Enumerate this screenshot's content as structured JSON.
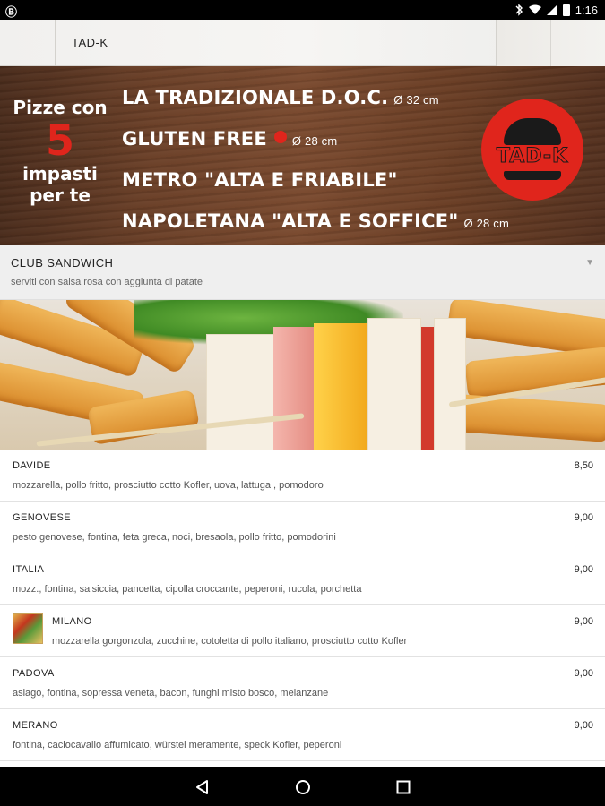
{
  "status_bar": {
    "app_icon": "app-notification-icon",
    "icons": [
      "bluetooth-icon",
      "wifi-icon",
      "signal-icon",
      "battery-icon"
    ],
    "time": "1:16"
  },
  "app_bar": {
    "title": "TAD-K"
  },
  "banner": {
    "left_text_top": "Pizze con",
    "big_number": "5",
    "left_text_bottom": "impasti per te",
    "lines": [
      {
        "label": "LA TRADIZIONALE  D.O.C.",
        "size": "Ø 32 cm"
      },
      {
        "label": "GLUTEN FREE",
        "size": "Ø 28 cm"
      },
      {
        "label": "METRO \"ALTA E FRIABILE\"",
        "size": ""
      },
      {
        "label": "NAPOLETANA \"ALTA E SOFFICE\"",
        "size": "Ø 28 cm"
      }
    ],
    "logo_text": "TAD-K",
    "colors": {
      "accent": "#e0251c",
      "wood": "#6b4028"
    }
  },
  "section": {
    "title": "CLUB SANDWICH",
    "subtitle": "serviti con salsa rosa con aggiunta di patate",
    "expand_icon": "chevron-down-icon"
  },
  "items": [
    {
      "name": "DAVIDE",
      "price": "8,50",
      "desc": "mozzarella, pollo fritto, prosciutto cotto Kofler, uova, lattuga , pomodoro"
    },
    {
      "name": "GENOVESE",
      "price": "9,00",
      "desc": "pesto genovese, fontina, feta greca, noci, bresaola, pollo fritto, pomodorini"
    },
    {
      "name": "ITALIA",
      "price": "9,00",
      "desc": "mozz., fontina, salsiccia, pancetta, cipolla croccante, peperoni, rucola, porchetta"
    },
    {
      "name": "MILANO",
      "price": "9,00",
      "desc": "mozzarella gorgonzola, zucchine, cotoletta di pollo italiano, prosciutto cotto Kofler"
    },
    {
      "name": "PADOVA",
      "price": "9,00",
      "desc": "asiago, fontina, sopressa veneta, bacon, funghi misto bosco, melanzane"
    },
    {
      "name": "MERANO",
      "price": "9,00",
      "desc": "fontina, caciocavallo affumicato, würstel meramente, speck Kofler, peperoni"
    }
  ],
  "nav_bar": {
    "icons": [
      "back-icon",
      "home-icon",
      "recents-icon"
    ]
  }
}
